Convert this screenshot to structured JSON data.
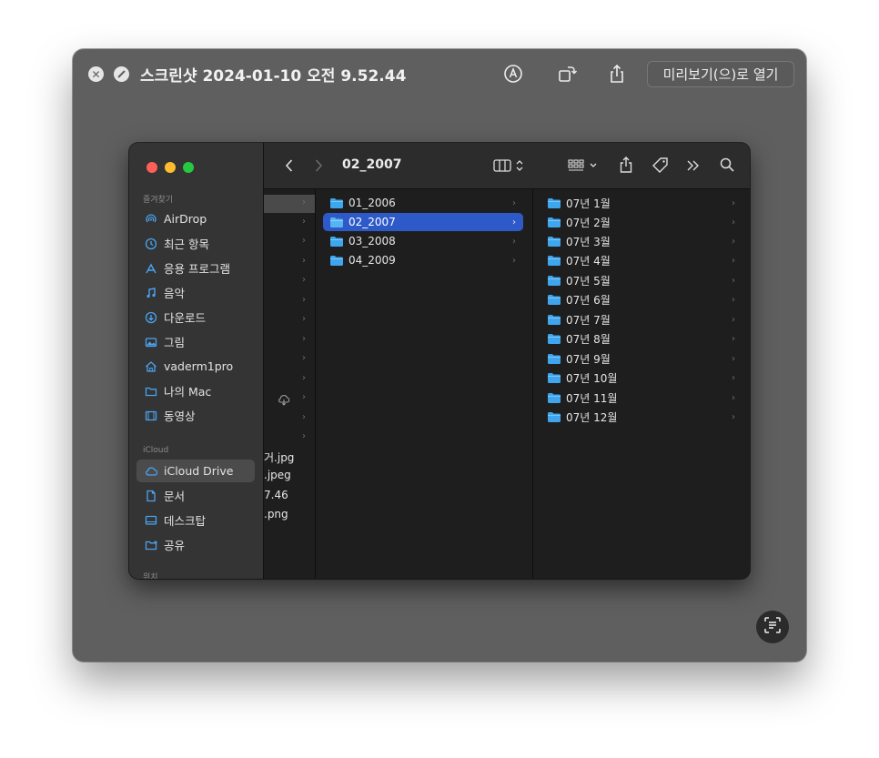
{
  "window": {
    "title": "스크린샷 2024-01-10 오전 9.52.44",
    "open_button_label": "미리보기(으)로 열기",
    "close_icon": "close-icon",
    "fullscreen_icon": "fullscreen-icon"
  },
  "finder": {
    "path_title": "02_2007",
    "sidebar": {
      "favorites_header": "즐겨찾기",
      "favorites": [
        {
          "label": "AirDrop",
          "icon": "airdrop-icon"
        },
        {
          "label": "최근 항목",
          "icon": "clock-icon"
        },
        {
          "label": "응용 프로그램",
          "icon": "applications-icon"
        },
        {
          "label": "음악",
          "icon": "music-icon"
        },
        {
          "label": "다운로드",
          "icon": "download-icon"
        },
        {
          "label": "그림",
          "icon": "pictures-icon"
        },
        {
          "label": "vaderm1pro",
          "icon": "home-icon"
        },
        {
          "label": "나의 Mac",
          "icon": "folder-icon"
        },
        {
          "label": "동영상",
          "icon": "movies-icon"
        }
      ],
      "icloud_header": "iCloud",
      "icloud": [
        {
          "label": "iCloud Drive",
          "icon": "cloud-icon",
          "selected": true
        },
        {
          "label": "문서",
          "icon": "document-icon"
        },
        {
          "label": "데스크탑",
          "icon": "desktop-icon"
        },
        {
          "label": "공유",
          "icon": "shared-folder-icon"
        }
      ],
      "locations_header": "위치"
    },
    "column1_files": [
      "거.jpg",
      ".jpeg",
      "7.46",
      ".png"
    ],
    "column2": [
      {
        "label": "01_2006",
        "selected": false
      },
      {
        "label": "02_2007",
        "selected": true
      },
      {
        "label": "03_2008",
        "selected": false
      },
      {
        "label": "04_2009",
        "selected": false
      }
    ],
    "column3": [
      {
        "label": "07년 1월"
      },
      {
        "label": "07년 2월"
      },
      {
        "label": "07년 3월"
      },
      {
        "label": "07년 4월"
      },
      {
        "label": "07년 5월"
      },
      {
        "label": "07년 6월"
      },
      {
        "label": "07년 7월"
      },
      {
        "label": "07년 8월"
      },
      {
        "label": "07년 9월"
      },
      {
        "label": "07년 10월"
      },
      {
        "label": "07년 11월"
      },
      {
        "label": "07년 12월"
      }
    ],
    "colors": {
      "selection": "#2d5ac8",
      "folder": "#3fa6ee",
      "traffic_red": "#ff5f57",
      "traffic_yellow": "#febc2e",
      "traffic_green": "#28c840"
    }
  }
}
